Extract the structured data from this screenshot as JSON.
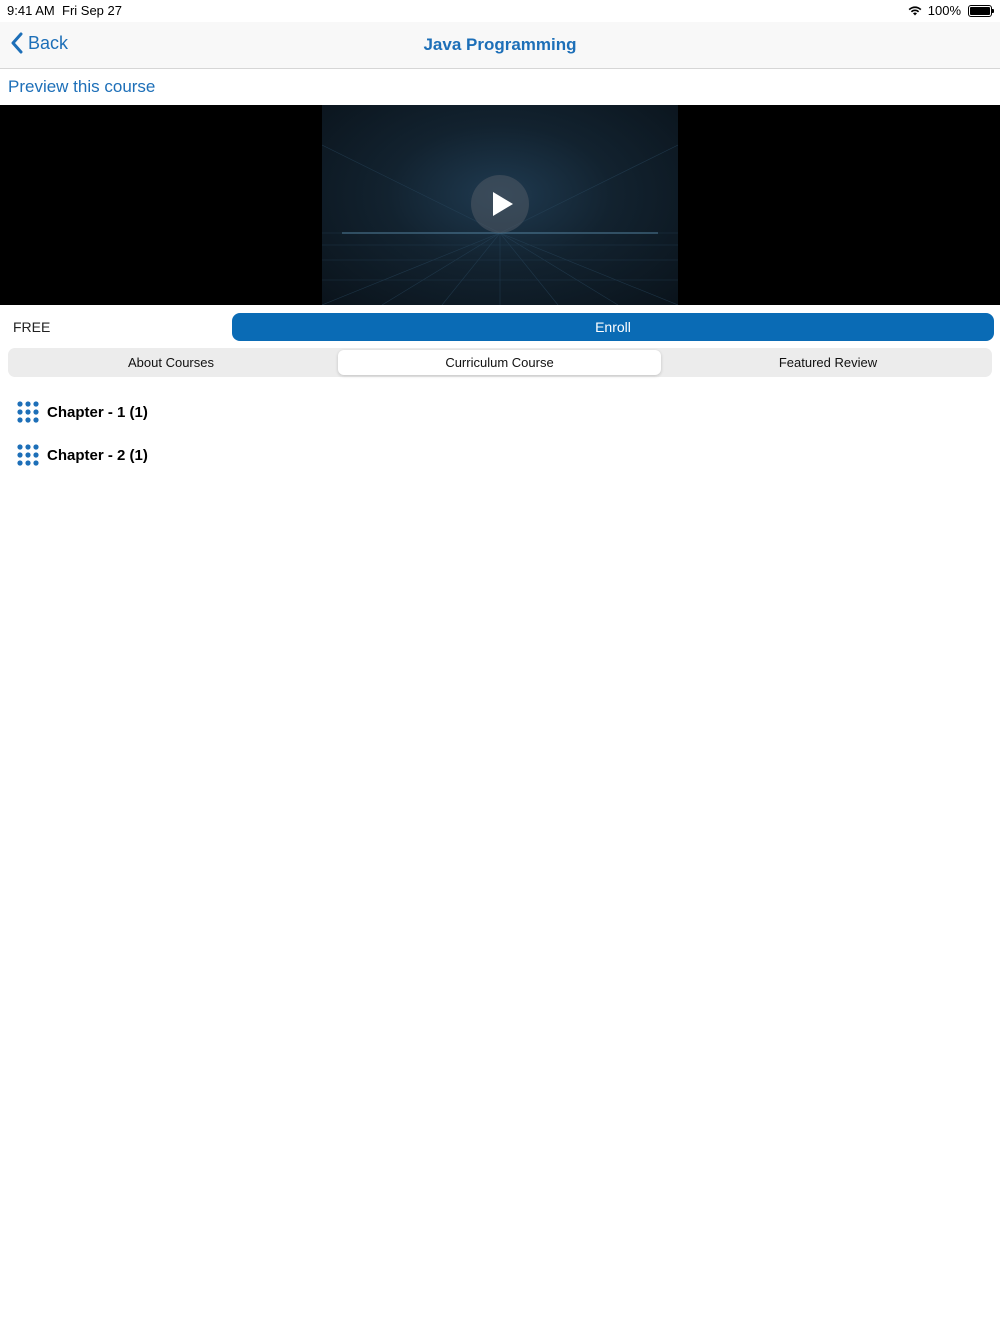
{
  "status_bar": {
    "time": "9:41 AM",
    "date": "Fri Sep 27",
    "battery": "100%",
    "icons": [
      "wifi-icon",
      "battery-icon"
    ]
  },
  "nav": {
    "back_label": "Back",
    "title": "Java Programming",
    "back_icon": "chevron-left-icon"
  },
  "preview_link": "Preview this course",
  "video": {
    "play_icon": "play-icon"
  },
  "price": "FREE",
  "enroll_label": "Enroll",
  "tabs": [
    {
      "label": "About Courses",
      "active": false
    },
    {
      "label": "Curriculum Course",
      "active": true
    },
    {
      "label": "Featured Review",
      "active": false
    }
  ],
  "chapters": [
    {
      "label": "Chapter - 1 (1)",
      "icon": "dots-grid-icon"
    },
    {
      "label": "Chapter - 2 (1)",
      "icon": "dots-grid-icon"
    }
  ],
  "colors": {
    "accent": "#1d6fb8",
    "enroll_button": "#0a6bb5",
    "segmented_bg": "#ececec"
  }
}
